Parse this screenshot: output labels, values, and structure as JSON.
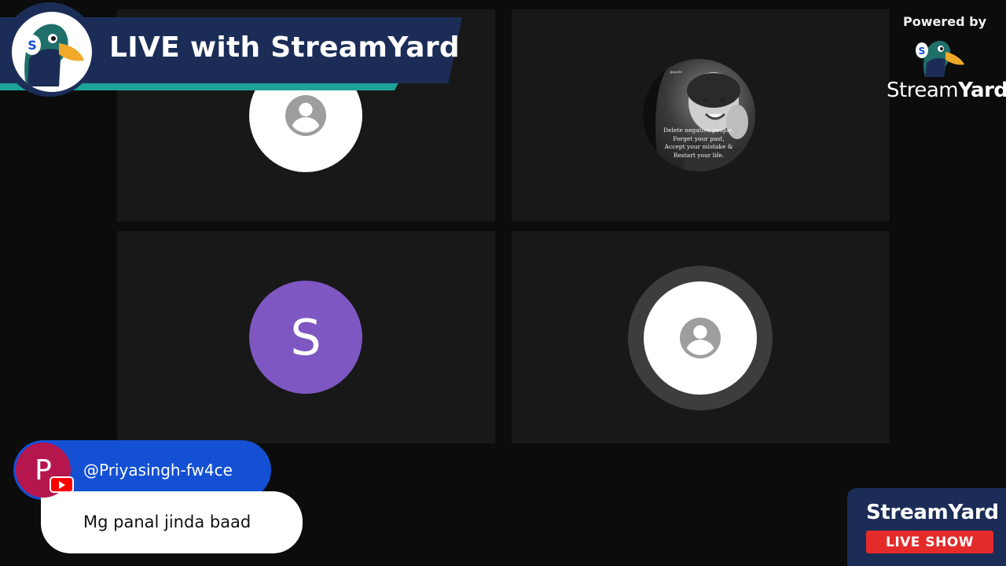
{
  "banner": {
    "title": "LIVE with StreamYard"
  },
  "branding": {
    "powered_by": "Powered by",
    "logo_text_regular": "Stream",
    "logo_text_bold": "Yard"
  },
  "participants": [
    {
      "slot": "top-left",
      "avatar": "default-person-icon"
    },
    {
      "slot": "top-right",
      "avatar": "photo",
      "photo_caption": [
        "Delete negative people,",
        "Forget your past,",
        "Accept your mistake &",
        "Restart your life."
      ]
    },
    {
      "slot": "bottom-left",
      "avatar": "initial",
      "initial": "S",
      "color": "#7e57c2"
    },
    {
      "slot": "bottom-right",
      "avatar": "default-person-icon",
      "speaking_ring": true
    }
  ],
  "comment": {
    "initial": "P",
    "handle": "@Priyasingh-fw4ce",
    "message": "Mg panal jinda baad",
    "platform": "youtube-icon"
  },
  "live_show": {
    "brand": "StreamYard",
    "label": "LIVE SHOW"
  },
  "colors": {
    "navy": "#1b2d57",
    "teal": "#1ea39a",
    "comment_blue": "#1350d4",
    "live_red": "#e52a2a",
    "avatar_purple": "#7e57c2",
    "comment_avatar": "#b5164e"
  }
}
